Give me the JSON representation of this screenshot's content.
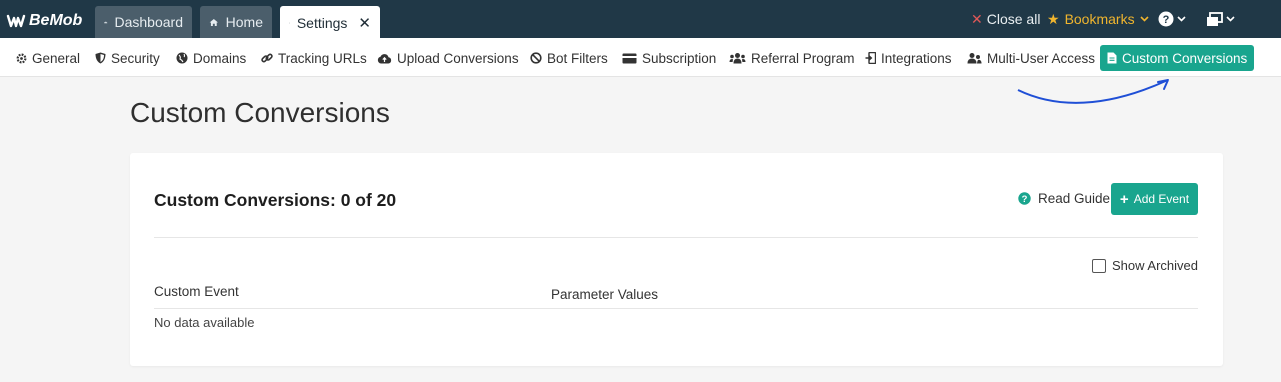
{
  "brand": {
    "logo_text": "BeMob"
  },
  "tabs": [
    {
      "label": "Dashboard",
      "icon": "dashboard-icon"
    },
    {
      "label": "Home",
      "icon": "home-icon"
    },
    {
      "label": "Settings",
      "icon": "gear-icon",
      "close": "✕"
    }
  ],
  "header_actions": {
    "close_all": "Close all",
    "bookmarks": "Bookmarks"
  },
  "settings_nav": [
    {
      "label": "General",
      "icon": "gear-icon"
    },
    {
      "label": "Security",
      "icon": "shield-icon"
    },
    {
      "label": "Domains",
      "icon": "globe-icon"
    },
    {
      "label": "Tracking URLs",
      "icon": "link-icon"
    },
    {
      "label": "Upload Conversions",
      "icon": "cloud-upload-icon"
    },
    {
      "label": "Bot Filters",
      "icon": "ban-icon"
    },
    {
      "label": "Subscription",
      "icon": "credit-card-icon"
    },
    {
      "label": "Referral Program",
      "icon": "users-icon"
    },
    {
      "label": "Integrations",
      "icon": "plug-icon"
    },
    {
      "label": "Multi-User Access",
      "icon": "user-group-icon"
    },
    {
      "label": "Custom Conversions",
      "icon": "file-icon",
      "active": true
    }
  ],
  "page": {
    "title": "Custom Conversions",
    "card_title": "Custom Conversions: 0 of 20",
    "read_guide": "Read Guide",
    "add_event": "Add Event",
    "show_archived": "Show Archived",
    "columns": [
      "Custom Event",
      "Parameter Values"
    ],
    "empty_text": "No data available"
  },
  "colors": {
    "topbar": "#203847",
    "accent": "#19a58e",
    "bookmarks": "#f0b52e",
    "close_x": "#e05858",
    "annotation_arrow": "#1f4fd6"
  }
}
